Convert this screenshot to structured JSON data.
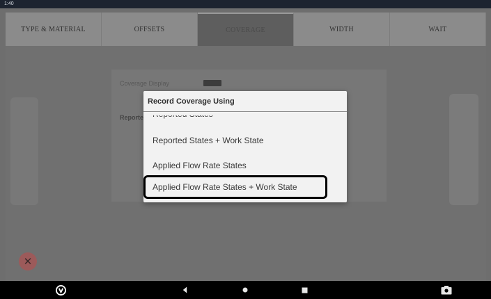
{
  "status_bar": {
    "time": "1:40"
  },
  "tabs": [
    {
      "label": "TYPE & MATERIAL",
      "active": false
    },
    {
      "label": "OFFSETS",
      "active": false
    },
    {
      "label": "COVERAGE",
      "active": true
    },
    {
      "label": "WIDTH",
      "active": false
    },
    {
      "label": "WAIT",
      "active": false
    }
  ],
  "background": {
    "row1_label": "Coverage Display",
    "row2_label": "Reported States"
  },
  "dialog": {
    "title": "Record Coverage Using",
    "options": [
      "Reported States",
      "Reported States + Work State",
      "Applied Flow Rate States",
      "Applied Flow Rate States + Work State"
    ],
    "highlighted_index": 3
  },
  "colors": {
    "dialog_bg": "#f2f2f2",
    "overlay": "#6e6e6e",
    "highlight_border": "#000000"
  }
}
